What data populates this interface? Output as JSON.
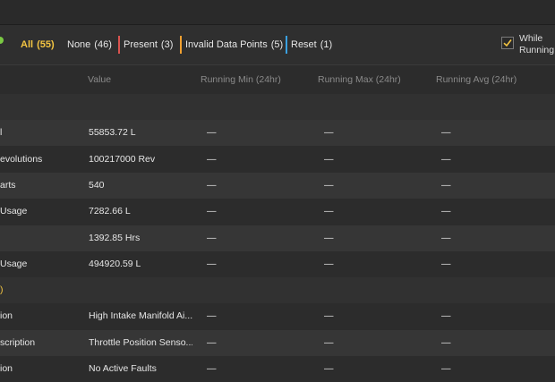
{
  "filters": {
    "dot_color": "#7ac943",
    "items": [
      {
        "label": "All",
        "count": "(55)",
        "active": true,
        "bar_color": ""
      },
      {
        "label": "None",
        "count": "(46)",
        "active": false,
        "bar_color": ""
      },
      {
        "label": "Present",
        "count": "(3)",
        "active": false,
        "bar_color": "#d9534f"
      },
      {
        "label": "Invalid Data Points",
        "count": "(5)",
        "active": false,
        "bar_color": "#f0a030"
      },
      {
        "label": "Reset",
        "count": "(1)",
        "active": false,
        "bar_color": "#3aa0e0"
      }
    ],
    "while_running": {
      "line1": "While",
      "line2": "Running",
      "checked": true,
      "check_color": "#f4c542"
    }
  },
  "columns": {
    "value": "Value",
    "min": "Running Min (24hr)",
    "max": "Running Max (24hr)",
    "avg": "Running Avg (24hr)"
  },
  "rows": [
    {
      "kind": "section",
      "name": ""
    },
    {
      "kind": "data",
      "name": "l",
      "value": "55853.72 L",
      "min": "—",
      "max": "—",
      "avg": "—"
    },
    {
      "kind": "data",
      "name": "evolutions",
      "value": "100217000 Rev",
      "min": "—",
      "max": "—",
      "avg": "—"
    },
    {
      "kind": "data",
      "name": "arts",
      "value": "540",
      "min": "—",
      "max": "—",
      "avg": "—"
    },
    {
      "kind": "data",
      "name": "Usage",
      "value": "7282.66 L",
      "min": "—",
      "max": "—",
      "avg": "—"
    },
    {
      "kind": "data",
      "name": "",
      "value": "1392.85 Hrs",
      "min": "—",
      "max": "—",
      "avg": "—"
    },
    {
      "kind": "data",
      "name": "Usage",
      "value": "494920.59 L",
      "min": "—",
      "max": "—",
      "avg": "—"
    },
    {
      "kind": "section",
      "name": ")"
    },
    {
      "kind": "data",
      "name": "ion",
      "value": "High Intake Manifold Ai...",
      "min": "—",
      "max": "—",
      "avg": "—"
    },
    {
      "kind": "data",
      "name": "scription",
      "value": "Throttle Position Senso...",
      "min": "—",
      "max": "—",
      "avg": "—"
    },
    {
      "kind": "data",
      "name": "ion",
      "value": "No Active Faults",
      "min": "—",
      "max": "—",
      "avg": "—"
    }
  ]
}
